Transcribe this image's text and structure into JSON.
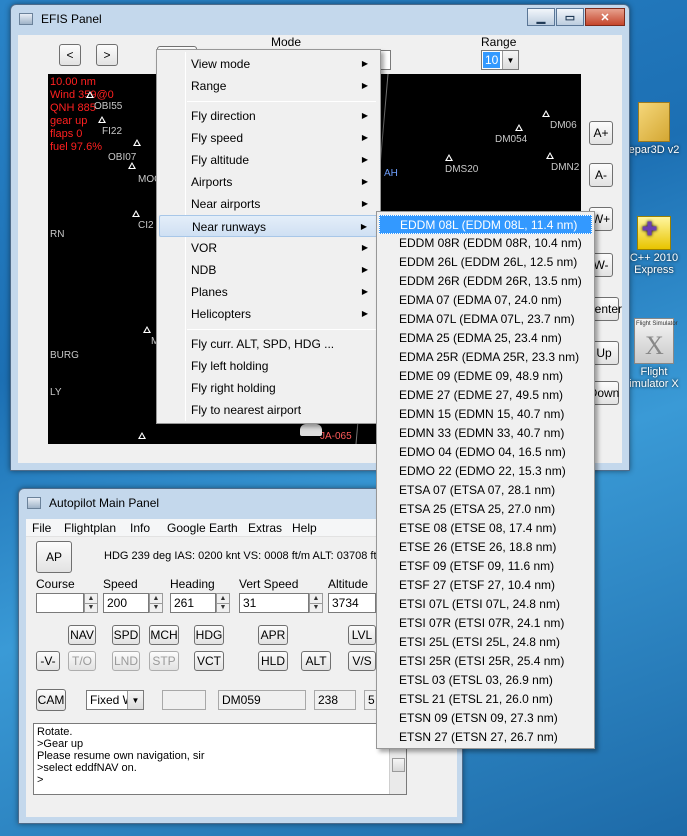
{
  "efis": {
    "title": "EFIS Panel",
    "prev_btn": "<",
    "next_btn": ">",
    "mode_label": "Mode",
    "range_label": "Range",
    "range_value": "10",
    "overlay": [
      "10.00 nm",
      "Wind 359@0",
      "QNH 885",
      "gear up",
      "flaps 0",
      "fuel 97.6%"
    ],
    "map_labels": [
      "OBI55",
      "FI22",
      "OBI07",
      "MOO",
      "RN",
      "CI2",
      "BURG",
      "LY",
      "DM054",
      "DM06",
      "DMS20",
      "DMN2",
      "AH",
      "JA-065",
      "M"
    ],
    "side_buttons": [
      "A+",
      "A-",
      "W+",
      "W-",
      "Center",
      "Up",
      "Down"
    ]
  },
  "context_menu": {
    "items": [
      "View mode",
      "Range",
      "Fly direction",
      "Fly speed",
      "Fly altitude",
      "Airports",
      "Near airports",
      "Near runways",
      "VOR",
      "NDB",
      "Planes",
      "Helicopters",
      "Fly curr. ALT, SPD, HDG ...",
      "Fly left holding",
      "Fly right holding",
      "Fly to nearest airport"
    ]
  },
  "runways": {
    "items": [
      "EDDM 08L (EDDM 08L, 11.4 nm)",
      "EDDM 08R (EDDM 08R, 10.4 nm)",
      "EDDM 26L (EDDM 26L, 12.5 nm)",
      "EDDM 26R (EDDM 26R, 13.5 nm)",
      "EDMA 07 (EDMA 07, 24.0 nm)",
      "EDMA 07L (EDMA 07L, 23.7 nm)",
      "EDMA 25 (EDMA 25, 23.4 nm)",
      "EDMA 25R (EDMA 25R, 23.3 nm)",
      "EDME 09 (EDME 09, 48.9 nm)",
      "EDME 27 (EDME 27, 49.5 nm)",
      "EDMN 15 (EDMN 15, 40.7 nm)",
      "EDMN 33 (EDMN 33, 40.7 nm)",
      "EDMO 04 (EDMO 04, 16.5 nm)",
      "EDMO 22 (EDMO 22, 15.3 nm)",
      "ETSA 07 (ETSA 07, 28.1 nm)",
      "ETSA 25 (ETSA 25, 27.0 nm)",
      "ETSE 08 (ETSE 08, 17.4 nm)",
      "ETSE 26 (ETSE 26, 18.8 nm)",
      "ETSF 09 (ETSF 09, 11.6 nm)",
      "ETSF 27 (ETSF 27, 10.4 nm)",
      "ETSI 07L (ETSI 07L, 24.8 nm)",
      "ETSI 07R (ETSI 07R, 24.1 nm)",
      "ETSI 25L (ETSI 25L, 24.8 nm)",
      "ETSI 25R (ETSI 25R, 25.4 nm)",
      "ETSL 03 (ETSL 03, 26.9 nm)",
      "ETSL 21 (ETSL 21, 26.0 nm)",
      "ETSN 09 (ETSN 09, 27.3 nm)",
      "ETSN 27 (ETSN 27, 26.7 nm)"
    ]
  },
  "autopilot": {
    "title": "Autopilot Main Panel",
    "menu": [
      "File",
      "Flightplan",
      "Info",
      "Google Earth",
      "Extras",
      "Help"
    ],
    "ap_button": "AP",
    "status": "HDG 239 deg IAS: 0200 knt VS: 0008 ft/m ALT: 03708 ft",
    "labels": {
      "course": "Course",
      "speed": "Speed",
      "heading": "Heading",
      "vert_speed": "Vert Speed",
      "altitude": "Altitude"
    },
    "values": {
      "course": "",
      "speed": "200",
      "heading": "261",
      "vert_speed": "31",
      "altitude": "3734"
    },
    "buttons": {
      "nav": "NAV",
      "spd": "SPD",
      "mch": "MCH",
      "hdg": "HDG",
      "apr": "APR",
      "lvl": "LVL",
      "minus_v": "-V-",
      "to": "T/O",
      "lnd": "LND",
      "stp": "STP",
      "vct": "VCT",
      "hld": "HLD",
      "alt": "ALT",
      "vs": "V/S",
      "cam": "CAM"
    },
    "fixed_select": "Fixed W",
    "waypoint": "DM059",
    "wp_value": "238",
    "wp_value2": "5",
    "log": [
      "Rotate.",
      ">Gear up",
      "Please resume own navigation, sir",
      ">select eddfNAV on.",
      ">"
    ]
  },
  "desktop": {
    "icons": [
      "epar3D v2",
      "C++ 2010 Express",
      "Flight imulator X"
    ],
    "fsx_logo_text": "Flight Simulator"
  },
  "colors": {
    "highlight": "#3399ff",
    "overlay_red": "#ff2020"
  }
}
